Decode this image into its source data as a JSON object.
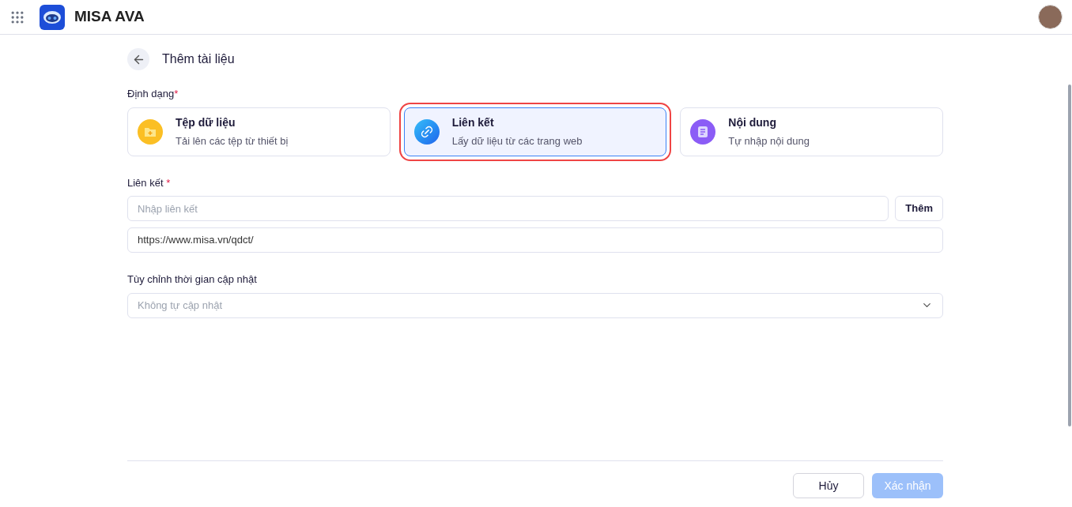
{
  "header": {
    "app_name": "MISA AVA"
  },
  "page": {
    "title": "Thêm tài liệu"
  },
  "format": {
    "label": "Định dạng",
    "required_mark": "*",
    "options": [
      {
        "kind": "file",
        "title": "Tệp dữ liệu",
        "description": "Tải lên các tệp từ thiết bị",
        "selected": false,
        "highlighted": false
      },
      {
        "kind": "link",
        "title": "Liên kết",
        "description": "Lấy dữ liệu từ các trang web",
        "selected": true,
        "highlighted": true
      },
      {
        "kind": "text",
        "title": "Nội dung",
        "description": "Tự nhập nội dung",
        "selected": false,
        "highlighted": false
      }
    ]
  },
  "link": {
    "label": "Liên kết",
    "required_mark": "*",
    "placeholder": "Nhập liên kết",
    "add_button": "Thêm",
    "links": [
      "https://www.misa.vn/qdct/"
    ]
  },
  "update_schedule": {
    "label": "Tùy chỉnh thời gian cập nhật",
    "placeholder": "Không tự cập nhật"
  },
  "footer": {
    "buttons": [
      {
        "kind": "secondary",
        "label": "Hủy",
        "disabled": false
      },
      {
        "kind": "primary",
        "label": "Xác nhận",
        "disabled": true
      }
    ]
  }
}
